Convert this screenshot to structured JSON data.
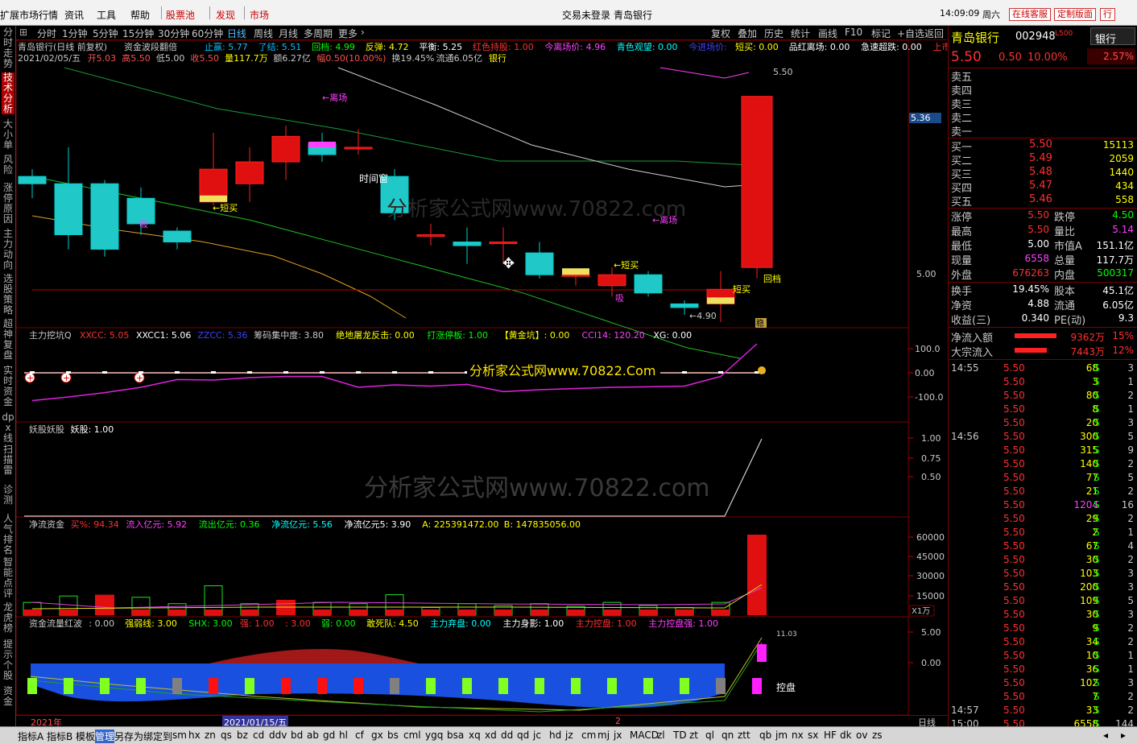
{
  "menu": {
    "items": [
      "扩展市场行情",
      "资讯",
      "工具",
      "帮助",
      "股票池",
      "发现",
      "市场"
    ],
    "center": "交易未登录",
    "center_stock": "青岛银行",
    "time": "14:09:09",
    "weekday": "周六",
    "btn1": "在线客服",
    "btn2": "定制版面",
    "btn3": "行"
  },
  "left_tabs": [
    "分时走势",
    "技术分析",
    "大小单",
    "风险",
    "涨停原因",
    "主力动向",
    "选股策略",
    "超神复盘",
    "实时资金",
    "dpx线",
    "扫描雷",
    "诊测",
    "人气排名",
    "智能点评",
    "龙虎榜",
    "提示个股",
    "资金"
  ],
  "topbar": {
    "items": [
      "分时",
      "1分钟",
      "5分钟",
      "15分钟",
      "30分钟",
      "60分钟",
      "日线",
      "周线",
      "月线",
      "多周期",
      "更多"
    ],
    "right": [
      "复权",
      "叠加",
      "历史",
      "统计",
      "画线",
      "F10",
      "标记",
      "+自选",
      "返回"
    ]
  },
  "main_info": {
    "title": "青岛银行(日线 前复权)",
    "indicator": "资金波段翻倍",
    "line1": [
      {
        "t": "止赢: 5.77",
        "c": "#00c0ff"
      },
      {
        "t": "了结: 5.51",
        "c": "#00c0ff"
      },
      {
        "t": "回档: 4.99",
        "c": "#00ff00"
      },
      {
        "t": "反弹: 4.72",
        "c": "#ffff00"
      },
      {
        "t": "平衡: 5.25",
        "c": "#ffffff"
      },
      {
        "t": "红色持股: 1.00",
        "c": "#ff3030"
      },
      {
        "t": "今离场价: 4.96",
        "c": "#ff40ff"
      },
      {
        "t": "青色观望: 0.00",
        "c": "#00ffff"
      },
      {
        "t": "今进场价:",
        "c": "#4040ff"
      },
      {
        "t": "短买: 0.00",
        "c": "#ffff00"
      },
      {
        "t": "品红离场: 0.00",
        "c": "#ffffff"
      },
      {
        "t": "急速超跌: 0.00",
        "c": "#ffffff"
      },
      {
        "t": "上市日期年◇",
        "c": "#ff3030"
      }
    ],
    "line2": [
      {
        "t": "2021/02/05/五",
        "c": "#c8c8c8"
      },
      {
        "t": "开5.03",
        "c": "#ff5050"
      },
      {
        "t": "高5.50",
        "c": "#ff5050"
      },
      {
        "t": "低5.00",
        "c": "#c8c8c8"
      },
      {
        "t": "收5.50",
        "c": "#ff5050"
      },
      {
        "t": "量117.7万",
        "c": "#ffff00"
      },
      {
        "t": "额6.27亿",
        "c": "#c8c8c8"
      },
      {
        "t": "幅0.50(10.00%)",
        "c": "#ff5050"
      },
      {
        "t": "换19.45%",
        "c": "#c8c8c8"
      },
      {
        "t": "流通6.05亿",
        "c": "#c8c8c8"
      },
      {
        "t": "银行",
        "c": "#ffff00"
      }
    ]
  },
  "main_labels": {
    "high_mark": "5.50",
    "low_mark": "←4.90",
    "li_chang1": "←离场",
    "li_chang2": "←离场",
    "duan_mai1": "←短买",
    "duan_mai2": "←短买",
    "duan_mai3": "短买",
    "xi1": "吸",
    "xi2": "吸",
    "hui_dang": "回档",
    "shi_jian": "时间窗",
    "wen": "稳",
    "cursor_price": "5.36",
    "axis_500": "5.00"
  },
  "watermarks": [
    "分析家公式网www.70822.com",
    "分析家公式网www.70822.Com",
    "分析家公式网www.70822.com"
  ],
  "p2": {
    "title": "主力挖坑Q",
    "items": [
      {
        "t": "XXCC: 5.05",
        "c": "#ff3030"
      },
      {
        "t": "XXCC1: 5.06",
        "c": "#ffffff"
      },
      {
        "t": "ZZCC: 5.36",
        "c": "#4040ff"
      },
      {
        "t": "筹码集中度: 3.80",
        "c": "#c8c8c8"
      },
      {
        "t": "绝地屠龙反击: 0.00",
        "c": "#ffff00"
      },
      {
        "t": "打涨停板: 1.00",
        "c": "#00ff00"
      },
      {
        "t": "【黄金坑】: 0.00",
        "c": "#ffff00"
      },
      {
        "t": "CCI14: 120.20",
        "c": "#ff40ff"
      },
      {
        "t": "XG: 0.00",
        "c": "#ffffff"
      }
    ],
    "axis": [
      "100.0",
      "0.00",
      "-100.0"
    ]
  },
  "p3": {
    "title": "妖股妖股",
    "items": [
      {
        "t": "妖股: 1.00",
        "c": "#ffffff"
      }
    ],
    "axis": [
      "1.00",
      "0.75",
      "0.50"
    ]
  },
  "p4": {
    "title": "净流资金",
    "items": [
      {
        "t": "买%: 94.34",
        "c": "#ff3030"
      },
      {
        "t": "流入亿元: 5.92",
        "c": "#ff40ff"
      },
      {
        "t": "流出亿元: 0.36",
        "c": "#00ff00"
      },
      {
        "t": "净流亿元: 5.56",
        "c": "#00ffff"
      },
      {
        "t": "净流亿元5: 3.90",
        "c": "#ffffff"
      },
      {
        "t": "A: 225391472.00",
        "c": "#ffff00"
      },
      {
        "t": "B: 147835056.00",
        "c": "#ffff00"
      }
    ],
    "axis": [
      "60000",
      "45000",
      "30000",
      "15000"
    ],
    "unit": "X1万"
  },
  "p5": {
    "title": "资金流量红波",
    "items": [
      {
        "t": ": 0.00",
        "c": "#c8c8c8"
      },
      {
        "t": "强弱线: 3.00",
        "c": "#ffff00"
      },
      {
        "t": "SHX: 3.00",
        "c": "#00ff00"
      },
      {
        "t": "强: 1.00",
        "c": "#ff3030"
      },
      {
        "t": ": 3.00",
        "c": "#ff3030"
      },
      {
        "t": "弱: 0.00",
        "c": "#00ff00"
      },
      {
        "t": "敢死队: 4.50",
        "c": "#ffff00"
      },
      {
        "t": "主力弃盘: 0.00",
        "c": "#00ffff"
      },
      {
        "t": "主力身影: 1.00",
        "c": "#ffffff"
      },
      {
        "t": "主力控盘: 1.00",
        "c": "#ff3030"
      },
      {
        "t": "主力控盘强: 1.00",
        "c": "#ff40ff"
      }
    ],
    "axis": [
      "5.00",
      "0.00"
    ],
    "kongpan": "控盘",
    "peak": "11.03"
  },
  "bottom": {
    "year": "2021年",
    "date": "2021/01/15/五",
    "mark": "2",
    "period": "日线"
  },
  "quote": {
    "name": "青岛银行",
    "code": "002948",
    "tag": "L500",
    "sector": "银行",
    "price": "5.50",
    "chg": "0.50",
    "pct": "10.00%",
    "amp": "2.57%",
    "sells": [
      "卖五",
      "卖四",
      "卖三",
      "卖二",
      "卖一"
    ],
    "buys": [
      {
        "l": "买一",
        "p": "5.50",
        "v": "15113"
      },
      {
        "l": "买二",
        "p": "5.49",
        "v": "2059"
      },
      {
        "l": "买三",
        "p": "5.48",
        "v": "1440"
      },
      {
        "l": "买四",
        "p": "5.47",
        "v": "434"
      },
      {
        "l": "买五",
        "p": "5.46",
        "v": "558"
      }
    ],
    "stats": [
      {
        "l": "涨停",
        "v": "5.50",
        "l2": "跌停",
        "v2": "4.50",
        "c": "#ff3030",
        "c2": "#00ff00"
      },
      {
        "l": "最高",
        "v": "5.50",
        "l2": "量比",
        "v2": "5.14",
        "c": "#ff3030",
        "c2": "#ff40ff"
      },
      {
        "l": "最低",
        "v": "5.00",
        "l2": "市值A",
        "v2": "151.1亿",
        "c": "#ffffff",
        "c2": "#ffffff"
      },
      {
        "l": "现量",
        "v": "6558",
        "l2": "总量",
        "v2": "117.7万",
        "c": "#ff40ff",
        "c2": "#ffffff"
      },
      {
        "l": "外盘",
        "v": "676263",
        "l2": "内盘",
        "v2": "500317",
        "c": "#ff3030",
        "c2": "#00ff00"
      }
    ],
    "stats2": [
      {
        "l": "换手",
        "v": "19.45%",
        "l2": "股本",
        "v2": "45.1亿"
      },
      {
        "l": "净资",
        "v": "4.88",
        "l2": "流通",
        "v2": "6.05亿"
      },
      {
        "l": "收益(三)",
        "v": "0.340",
        "l2": "PE(动)",
        "v2": "9.3"
      }
    ],
    "flows": [
      {
        "l": "净流入额",
        "v": "9362万",
        "p": "15%"
      },
      {
        "l": "大宗流入",
        "v": "7443万",
        "p": "12%"
      }
    ],
    "ticks": [
      {
        "t": "14:55",
        "p": "5.50",
        "v": "68",
        "n": "3"
      },
      {
        "t": "",
        "p": "5.50",
        "v": "3",
        "n": "1"
      },
      {
        "t": "",
        "p": "5.50",
        "v": "80",
        "n": "2"
      },
      {
        "t": "",
        "p": "5.50",
        "v": "8",
        "n": "1"
      },
      {
        "t": "",
        "p": "5.50",
        "v": "20",
        "n": "3"
      },
      {
        "t": "14:56",
        "p": "5.50",
        "v": "300",
        "n": "5"
      },
      {
        "t": "",
        "p": "5.50",
        "v": "315",
        "n": "9"
      },
      {
        "t": "",
        "p": "5.50",
        "v": "140",
        "n": "2"
      },
      {
        "t": "",
        "p": "5.50",
        "v": "77",
        "n": "5"
      },
      {
        "t": "",
        "p": "5.50",
        "v": "21",
        "n": "2"
      },
      {
        "t": "",
        "p": "5.50",
        "v": "1204",
        "n": "16"
      },
      {
        "t": "",
        "p": "5.50",
        "v": "29",
        "n": "2"
      },
      {
        "t": "",
        "p": "5.50",
        "v": "2",
        "n": "1"
      },
      {
        "t": "",
        "p": "5.50",
        "v": "67",
        "n": "4"
      },
      {
        "t": "",
        "p": "5.50",
        "v": "30",
        "n": "2"
      },
      {
        "t": "",
        "p": "5.50",
        "v": "103",
        "n": "3"
      },
      {
        "t": "",
        "p": "5.50",
        "v": "200",
        "n": "3"
      },
      {
        "t": "",
        "p": "5.50",
        "v": "109",
        "n": "5"
      },
      {
        "t": "",
        "p": "5.50",
        "v": "30",
        "n": "3"
      },
      {
        "t": "",
        "p": "5.50",
        "v": "9",
        "n": "2"
      },
      {
        "t": "",
        "p": "5.50",
        "v": "34",
        "n": "2"
      },
      {
        "t": "",
        "p": "5.50",
        "v": "10",
        "n": "1"
      },
      {
        "t": "",
        "p": "5.50",
        "v": "36",
        "n": "1"
      },
      {
        "t": "",
        "p": "5.50",
        "v": "102",
        "n": "3"
      },
      {
        "t": "",
        "p": "5.50",
        "v": "7",
        "n": "2"
      },
      {
        "t": "14:57",
        "p": "5.50",
        "v": "33",
        "n": "2"
      },
      {
        "t": "15:00",
        "p": "5.50",
        "v": "6558",
        "n": "144"
      }
    ]
  },
  "bottom_tabs": [
    "指标A",
    "指标B",
    "模",
    "板",
    "管理",
    "另存为",
    "绑定到",
    "sm",
    "hx",
    "zn",
    "qs",
    "bz",
    "cd",
    "ddv",
    "bd",
    "ab",
    "gd",
    "hl",
    "cf",
    "gx",
    "bs",
    "cml",
    "ygq",
    "bsa",
    "xq",
    "xd",
    "dd",
    "qd",
    "jc",
    "hd",
    "jz",
    "cm",
    "mj",
    "jx",
    "MACD",
    "zl",
    "TD",
    "zt",
    "ql",
    "qn",
    "ztt",
    "qb",
    "jm",
    "nx",
    "sx",
    "HF",
    "dk",
    "ov",
    "zs"
  ],
  "chart_data": {
    "type": "candlestick",
    "candles": [
      {
        "o": 5.28,
        "c": 5.26,
        "h": 5.3,
        "l": 5.22
      },
      {
        "o": 5.26,
        "c": 5.12,
        "h": 5.36,
        "l": 5.08
      },
      {
        "o": 5.26,
        "c": 5.08,
        "h": 5.27,
        "l": 5.06
      },
      {
        "o": 5.22,
        "c": 5.15,
        "h": 5.25,
        "l": 5.12
      },
      {
        "o": 5.13,
        "c": 5.1,
        "h": 5.14,
        "l": 5.08
      },
      {
        "o": 5.21,
        "c": 5.3,
        "h": 5.4,
        "l": 5.2
      },
      {
        "o": 5.26,
        "c": 5.32,
        "h": 5.36,
        "l": 5.21
      },
      {
        "o": 5.32,
        "c": 5.39,
        "h": 5.42,
        "l": 5.27
      },
      {
        "o": 5.37,
        "c": 5.34,
        "h": 5.4,
        "l": 5.32
      },
      {
        "o": 5.36,
        "c": 5.36,
        "h": 5.41,
        "l": 5.34
      },
      {
        "o": 5.28,
        "c": 5.18,
        "h": 5.3,
        "l": 5.16
      },
      {
        "o": 5.12,
        "c": 5.12,
        "h": 5.15,
        "l": 5.09
      },
      {
        "o": 5.1,
        "c": 5.09,
        "h": 5.14,
        "l": 5.04
      },
      {
        "o": 5.1,
        "c": 5.1,
        "h": 5.14,
        "l": 5.04
      },
      {
        "o": 5.07,
        "c": 5.01,
        "h": 5.1,
        "l": 5.0
      },
      {
        "o": 5.01,
        "c": 5.01,
        "h": 5.02,
        "l": 4.98
      },
      {
        "o": 4.98,
        "c": 5.01,
        "h": 5.03,
        "l": 4.95
      },
      {
        "o": 5.01,
        "c": 4.96,
        "h": 5.02,
        "l": 4.95
      },
      {
        "o": 4.93,
        "c": 4.92,
        "h": 4.94,
        "l": 4.9
      },
      {
        "o": 4.93,
        "c": 4.97,
        "h": 5.02,
        "l": 4.88
      },
      {
        "o": 5.03,
        "c": 5.5,
        "h": 5.5,
        "l": 5.0
      }
    ],
    "ma_green": [
      5.28,
      5.25,
      5.22,
      5.19,
      5.16,
      5.12,
      5.08,
      5.04,
      5.0,
      4.96,
      4.91,
      4.86,
      4.81,
      4.78
    ],
    "macd": [
      -115,
      -100,
      -82,
      -60,
      -28,
      -30,
      -20,
      -15,
      -15,
      -60,
      -50,
      -55,
      -48,
      -78,
      -70,
      -65,
      -60,
      -58,
      -55,
      -15,
      120
    ],
    "volume": [
      [
        "g",
        10000
      ],
      [
        "g",
        15000
      ],
      [
        "r",
        16000
      ],
      [
        "g",
        14000
      ],
      [
        "g",
        9000
      ],
      [
        "g",
        23000
      ],
      [
        "g",
        9000
      ],
      [
        "r",
        12000
      ],
      [
        "g",
        10000
      ],
      [
        "g",
        9000
      ],
      [
        "g",
        16000
      ],
      [
        "g",
        6000
      ],
      [
        "g",
        9000
      ],
      [
        "g",
        7500
      ],
      [
        "g",
        9000
      ],
      [
        "g",
        7000
      ],
      [
        "g",
        10000
      ],
      [
        "g",
        7500
      ],
      [
        "g",
        6000
      ],
      [
        "g",
        10000
      ],
      [
        "r",
        63000
      ]
    ],
    "squares": [
      "g",
      "g",
      "g",
      "g",
      "gray",
      "r",
      "g",
      "r",
      "r",
      "r",
      "gray",
      "g",
      "g",
      "g",
      "g",
      "g",
      "g",
      "g",
      "g",
      "gray",
      "m"
    ],
    "ylim": [
      4.88,
      5.57
    ]
  }
}
